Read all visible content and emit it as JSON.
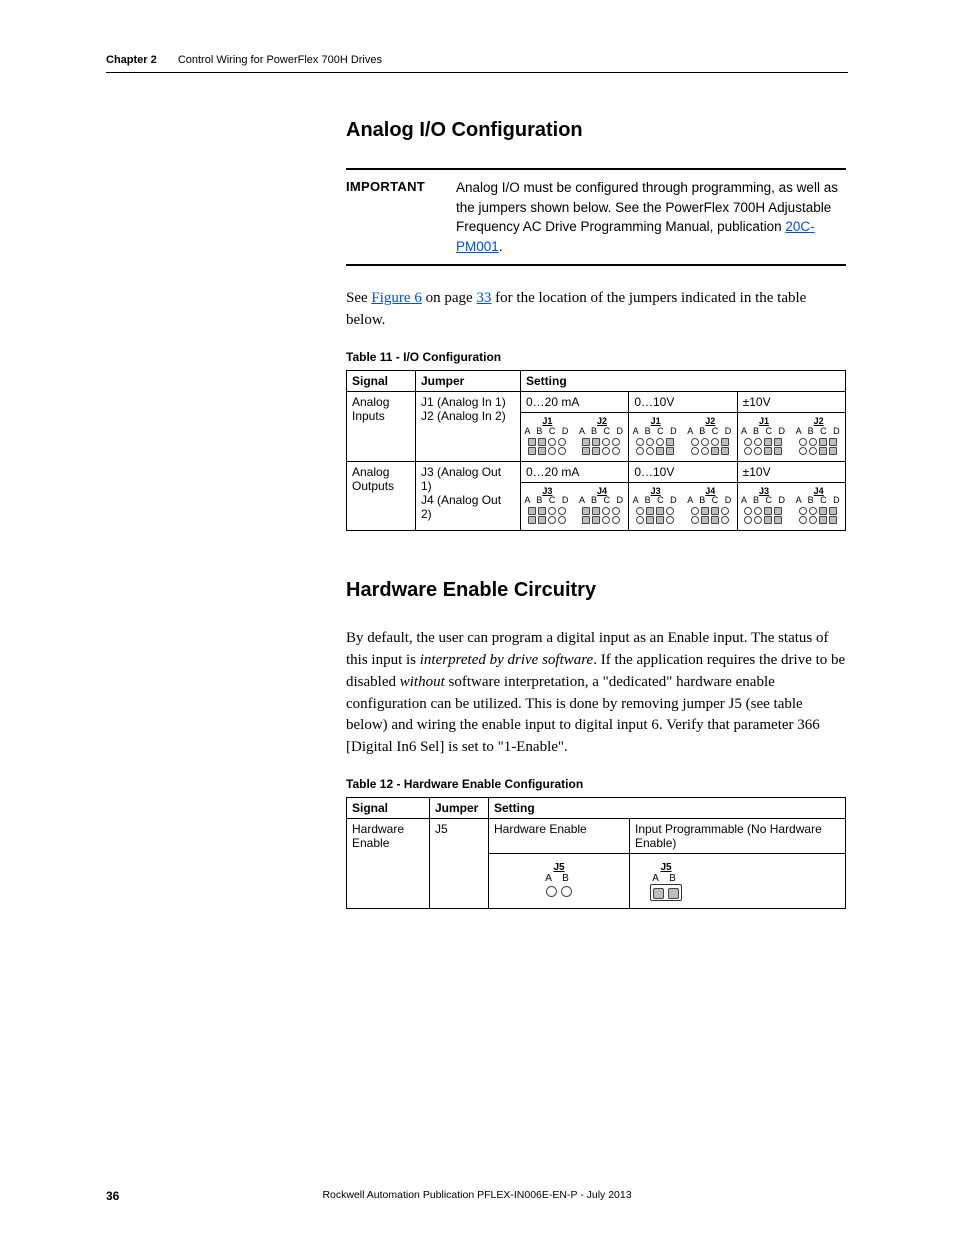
{
  "header": {
    "chapter": "Chapter 2",
    "section": "Control Wiring for PowerFlex 700H Drives"
  },
  "h1_analog": "Analog I/O Configuration",
  "important": {
    "label": "IMPORTANT",
    "text_pre": "Analog I/O must be configured through programming, as well as the jumpers shown below. See the PowerFlex 700H Adjustable Frequency AC Drive Programming Manual, publication ",
    "link": "20C-PM001",
    "text_post": "."
  },
  "see_figure": {
    "pre": "See ",
    "fig": "Figure 6",
    "mid": " on page ",
    "pg": "33",
    "post": " for the location of the jumpers indicated in the table below."
  },
  "table11": {
    "title": "Table 11 - I/O Configuration",
    "head": {
      "signal": "Signal",
      "jumper": "Jumper",
      "setting": "Setting"
    },
    "row_in": {
      "signal": "Analog Inputs",
      "jumpers": "J1 (Analog In 1)\nJ2 (Analog In 2)",
      "j_left": "J1",
      "j_right": "J2"
    },
    "row_out": {
      "signal": "Analog Outputs",
      "jumpers": "J3 (Analog Out 1)\nJ4 (Analog Out 2)",
      "j_left": "J3",
      "j_right": "J4"
    },
    "settings": {
      "s1": "0…20 mA",
      "s2": "0…10V",
      "s3": "±10V"
    },
    "letters": "A B C D"
  },
  "h1_hw": "Hardware Enable Circuitry",
  "hw_para": "By default, the user can program a digital input as an Enable input. The status of this input is <i>interpreted by drive software</i>. If the application requires the drive to be disabled <i>without</i> software interpretation, a \"dedicated\" hardware enable configuration can be utilized. This is done by removing jumper J5 (see table below) and wiring the enable input to digital input 6. Verify that parameter 366 [Digital In6 Sel] is set to \"1-Enable\".",
  "table12": {
    "title": "Table 12 - Hardware Enable Configuration",
    "head": {
      "signal": "Signal",
      "jumper": "Jumper",
      "setting": "Setting"
    },
    "signal": "Hardware Enable",
    "jumper": "J5",
    "opt1": "Hardware Enable",
    "opt2": "Input Programmable (No Hardware Enable)",
    "j5": "J5",
    "letters": "A  B"
  },
  "footer": {
    "page": "36",
    "pub": "Rockwell Automation Publication PFLEX-IN006E-EN-P - July 2013"
  }
}
